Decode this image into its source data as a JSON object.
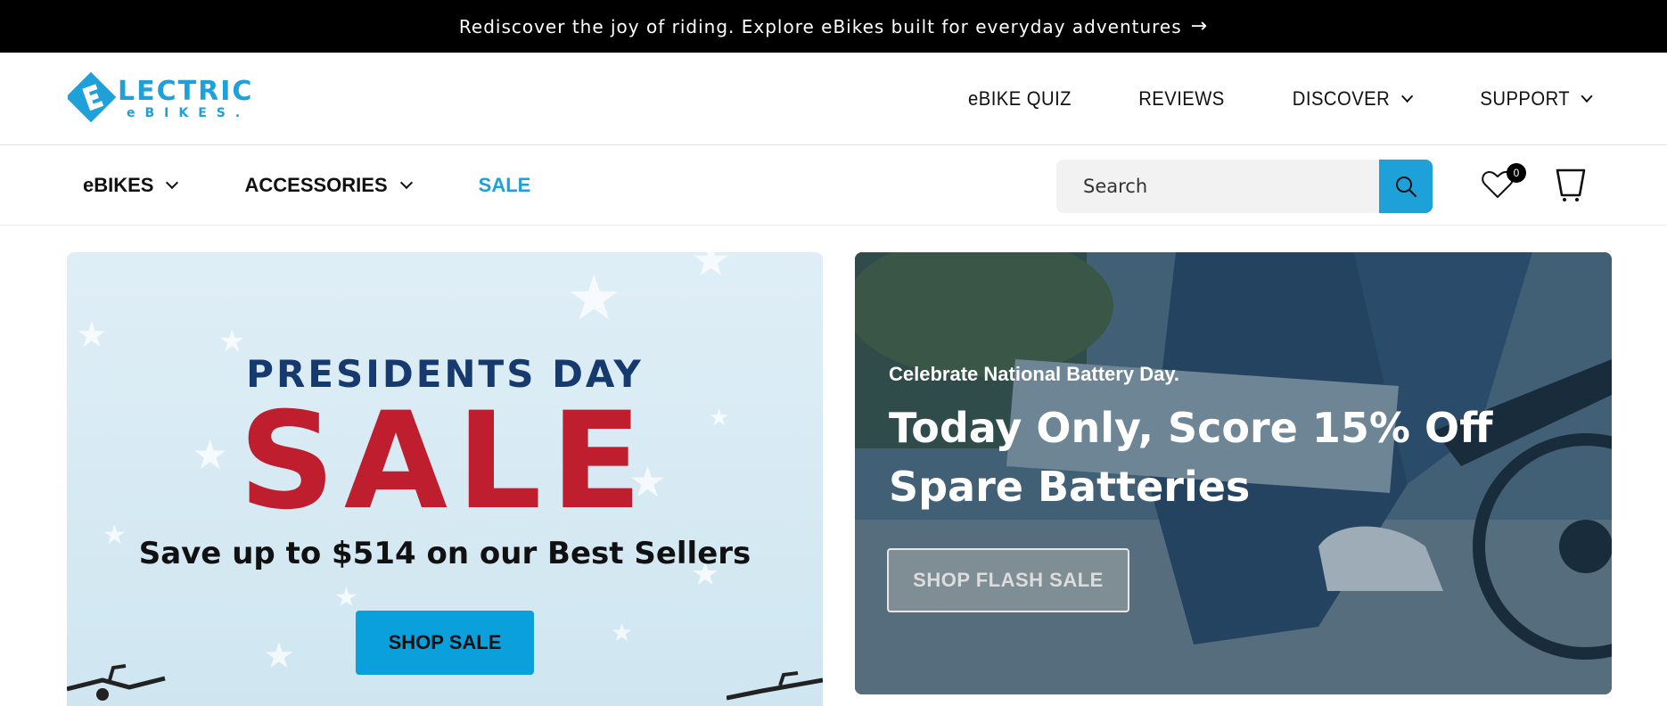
{
  "announcement": {
    "text": "Rediscover the joy of riding. Explore eBikes built for everyday adventures",
    "arrow": "→"
  },
  "header": {
    "logo": {
      "line1": "LECTRIC",
      "line2": "eBIKES."
    },
    "nav": [
      {
        "label": "eBIKE QUIZ",
        "dropdown": false
      },
      {
        "label": "REVIEWS",
        "dropdown": false
      },
      {
        "label": "DISCOVER",
        "dropdown": true
      },
      {
        "label": "SUPPORT",
        "dropdown": true
      }
    ]
  },
  "subnav": {
    "items": [
      {
        "label": "eBIKES",
        "dropdown": true
      },
      {
        "label": "ACCESSORIES",
        "dropdown": true
      },
      {
        "label": "SALE",
        "dropdown": false
      }
    ],
    "search": {
      "placeholder": "Search"
    },
    "wishlist_count": "0",
    "accent_color": "#1ea0d8"
  },
  "promo_left": {
    "eyebrow": "PRESIDENTS DAY",
    "headline": "SALE",
    "subhead": "Save up to $514 on our Best Sellers",
    "button": "SHOP SALE"
  },
  "promo_right": {
    "eyebrow": "Celebrate National Battery Day.",
    "headline": "Today Only, Score 15% Off Spare Batteries",
    "button": "SHOP FLASH SALE"
  }
}
